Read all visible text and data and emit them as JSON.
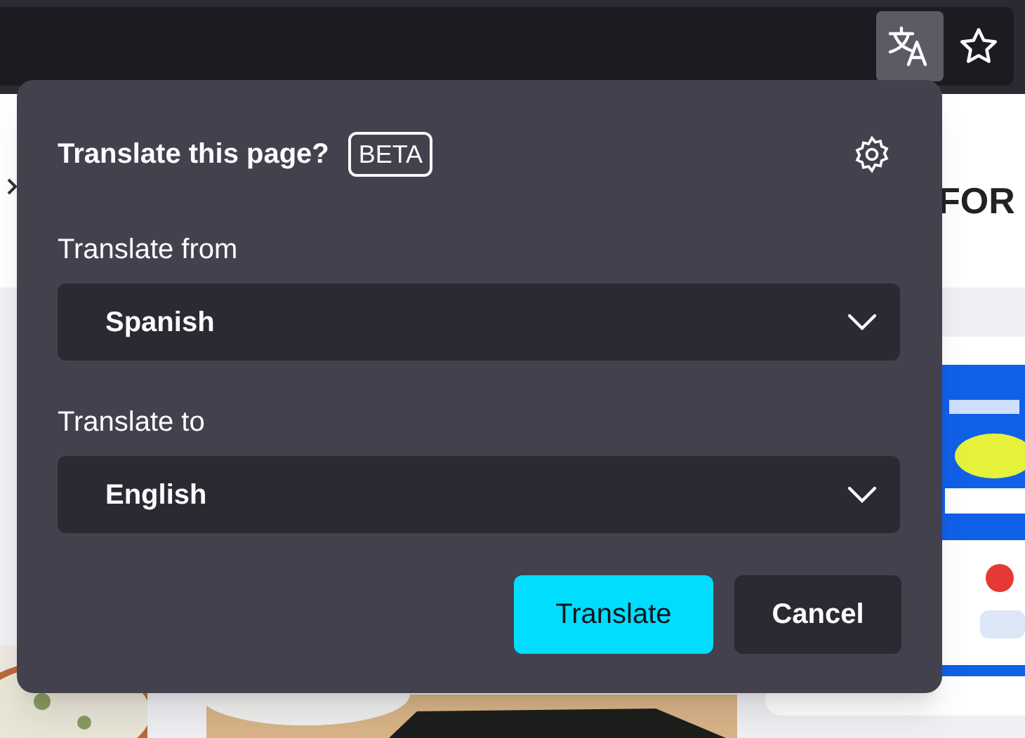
{
  "toolbar": {
    "translate_button": {
      "selected": true
    }
  },
  "page": {
    "heading": "FOR"
  },
  "popup": {
    "title": "Translate this page?",
    "badge": "BETA",
    "fields": [
      {
        "label": "Translate from",
        "value": "Spanish"
      },
      {
        "label": "Translate to",
        "value": "English"
      }
    ],
    "buttons": [
      {
        "label": "Translate",
        "kind": "primary"
      },
      {
        "label": "Cancel",
        "kind": "secondary"
      }
    ]
  }
}
